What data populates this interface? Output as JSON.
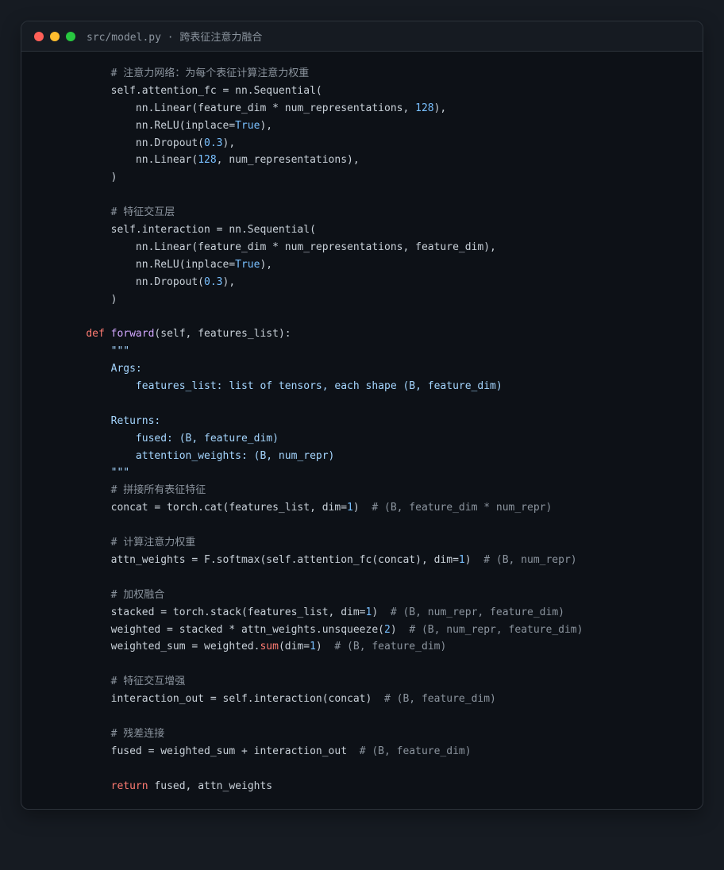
{
  "window": {
    "title": "src/model.py · 跨表征注意力融合",
    "traffic_lights": {
      "close": "#ff5f57",
      "minimize": "#febc2e",
      "maximize": "#28c840"
    }
  },
  "colors": {
    "background": "#161b22",
    "editor_bg": "#0d1117",
    "text": "#c9d1d9",
    "keyword": "#ff7b72",
    "function": "#d2a8ff",
    "number": "#79c0ff",
    "comment": "#8b949e",
    "docstring": "#a5d6ff"
  },
  "code_lines": [
    [
      [
        "        ",
        ""
      ],
      [
        "# 注意力网络：为每个表征计算注意力权重",
        "cm"
      ]
    ],
    [
      [
        "        self.attention_fc = nn.Sequential(",
        ""
      ]
    ],
    [
      [
        "            nn.Linear(feature_dim * num_representations, ",
        ""
      ],
      [
        "128",
        "num"
      ],
      [
        "),",
        ""
      ]
    ],
    [
      [
        "            nn.ReLU(inplace=",
        ""
      ],
      [
        "True",
        "num"
      ],
      [
        "),",
        ""
      ]
    ],
    [
      [
        "            nn.Dropout(",
        ""
      ],
      [
        "0.3",
        "num"
      ],
      [
        "),",
        ""
      ]
    ],
    [
      [
        "            nn.Linear(",
        ""
      ],
      [
        "128",
        "num"
      ],
      [
        ", num_representations),",
        ""
      ]
    ],
    [
      [
        "        )",
        ""
      ]
    ],
    [
      [
        "",
        ""
      ]
    ],
    [
      [
        "        ",
        ""
      ],
      [
        "# 特征交互层",
        "cm"
      ]
    ],
    [
      [
        "        self.interaction = nn.Sequential(",
        ""
      ]
    ],
    [
      [
        "            nn.Linear(feature_dim * num_representations, feature_dim),",
        ""
      ]
    ],
    [
      [
        "            nn.ReLU(inplace=",
        ""
      ],
      [
        "True",
        "num"
      ],
      [
        "),",
        ""
      ]
    ],
    [
      [
        "            nn.Dropout(",
        ""
      ],
      [
        "0.3",
        "num"
      ],
      [
        "),",
        ""
      ]
    ],
    [
      [
        "        )",
        ""
      ]
    ],
    [
      [
        "",
        ""
      ]
    ],
    [
      [
        "    ",
        ""
      ],
      [
        "def",
        "kw"
      ],
      [
        " ",
        ""
      ],
      [
        "forward",
        "fn"
      ],
      [
        "(self, features_list):",
        ""
      ]
    ],
    [
      [
        "        ",
        ""
      ],
      [
        "\"\"\"",
        "doc"
      ]
    ],
    [
      [
        "        ",
        ""
      ],
      [
        "Args:",
        "doc"
      ]
    ],
    [
      [
        "            ",
        ""
      ],
      [
        "features_list: list of tensors, each shape (B, feature_dim)",
        "doc"
      ]
    ],
    [
      [
        "",
        ""
      ]
    ],
    [
      [
        "        ",
        ""
      ],
      [
        "Returns:",
        "doc"
      ]
    ],
    [
      [
        "            ",
        ""
      ],
      [
        "fused: (B, feature_dim)",
        "doc"
      ]
    ],
    [
      [
        "            ",
        ""
      ],
      [
        "attention_weights: (B, num_repr)",
        "doc"
      ]
    ],
    [
      [
        "        ",
        ""
      ],
      [
        "\"\"\"",
        "doc"
      ]
    ],
    [
      [
        "        ",
        ""
      ],
      [
        "# 拼接所有表征特征",
        "cm"
      ]
    ],
    [
      [
        "        concat = torch.cat(features_list, dim=",
        ""
      ],
      [
        "1",
        "num"
      ],
      [
        ")  ",
        ""
      ],
      [
        "# (B, feature_dim * num_repr)",
        "cm"
      ]
    ],
    [
      [
        "",
        ""
      ]
    ],
    [
      [
        "        ",
        ""
      ],
      [
        "# 计算注意力权重",
        "cm"
      ]
    ],
    [
      [
        "        attn_weights = F.softmax(self.attention_fc(concat), dim=",
        ""
      ],
      [
        "1",
        "num"
      ],
      [
        ")  ",
        ""
      ],
      [
        "# (B, num_repr)",
        "cm"
      ]
    ],
    [
      [
        "",
        ""
      ]
    ],
    [
      [
        "        ",
        ""
      ],
      [
        "# 加权融合",
        "cm"
      ]
    ],
    [
      [
        "        stacked = torch.stack(features_list, dim=",
        ""
      ],
      [
        "1",
        "num"
      ],
      [
        ")  ",
        ""
      ],
      [
        "# (B, num_repr, feature_dim)",
        "cm"
      ]
    ],
    [
      [
        "        weighted = stacked * attn_weights.unsqueeze(",
        ""
      ],
      [
        "2",
        "num"
      ],
      [
        ")  ",
        ""
      ],
      [
        "# (B, num_repr, feature_dim)",
        "cm"
      ]
    ],
    [
      [
        "        weighted_sum = weighted.",
        ""
      ],
      [
        "sum",
        "kw"
      ],
      [
        "(dim=",
        ""
      ],
      [
        "1",
        "num"
      ],
      [
        ")  ",
        ""
      ],
      [
        "# (B, feature_dim)",
        "cm"
      ]
    ],
    [
      [
        "",
        ""
      ]
    ],
    [
      [
        "        ",
        ""
      ],
      [
        "# 特征交互增强",
        "cm"
      ]
    ],
    [
      [
        "        interaction_out = self.interaction(concat)  ",
        ""
      ],
      [
        "# (B, feature_dim)",
        "cm"
      ]
    ],
    [
      [
        "",
        ""
      ]
    ],
    [
      [
        "        ",
        ""
      ],
      [
        "# 残差连接",
        "cm"
      ]
    ],
    [
      [
        "        fused = weighted_sum + interaction_out  ",
        ""
      ],
      [
        "# (B, feature_dim)",
        "cm"
      ]
    ],
    [
      [
        "",
        ""
      ]
    ],
    [
      [
        "        ",
        ""
      ],
      [
        "return",
        "kw"
      ],
      [
        " fused, attn_weights",
        ""
      ]
    ]
  ]
}
